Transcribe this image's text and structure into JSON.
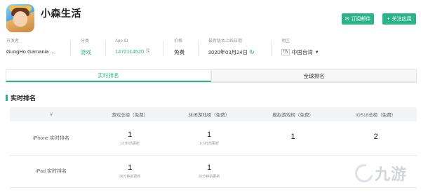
{
  "app": {
    "title": "小森生活",
    "icon": "app-icon"
  },
  "buttons": {
    "subscribe": {
      "label": "订阅邮件",
      "icon": "mail-icon"
    },
    "follow": {
      "label": "关注应用",
      "icon": "plus-icon"
    }
  },
  "meta": {
    "developer": {
      "label": "开发者",
      "value": "GungHo Gamania ..."
    },
    "category": {
      "label": "分类",
      "value": "游戏"
    },
    "app_id": {
      "label": "App ID",
      "value": "1472114520",
      "icon": "copy-icon"
    },
    "price": {
      "label": "价格",
      "value": "免费"
    },
    "release": {
      "label": "最新版本上线日期",
      "value": "2020年03月24日",
      "icon": "refresh-icon"
    },
    "region": {
      "label": "地区",
      "flag": "TW",
      "value": "中国台湾",
      "icon": "caret-down-icon"
    }
  },
  "tabs": [
    {
      "label": "实时排名",
      "active": true
    },
    {
      "label": "全球排名",
      "active": false
    }
  ],
  "section": {
    "title": "实时排名"
  },
  "table": {
    "headers": [
      "#",
      "游戏总榜（免费）",
      "休闲游戏榜（免费）",
      "模拟游戏榜（免费）",
      "iOS18总榜（免费）"
    ],
    "rows": [
      {
        "device": "iPhone 实时排名",
        "cells": [
          {
            "rank": "1",
            "update": "1小时前更新"
          },
          {
            "rank": "1",
            "update": "1小时前更新"
          },
          {
            "rank": "1",
            "update": ""
          },
          {
            "rank": "2",
            "update": ""
          }
        ]
      },
      {
        "device": "iPad 实时排名",
        "cells": [
          {
            "rank": "1",
            "update": "36分钟前更新"
          },
          {
            "rank": "1",
            "update": "35分钟前更新"
          },
          {
            "rank": "",
            "update": ""
          },
          {
            "rank": "",
            "update": ""
          }
        ]
      }
    ]
  },
  "watermark": {
    "text": "九游"
  },
  "colors": {
    "accent": "#2bb38a"
  }
}
